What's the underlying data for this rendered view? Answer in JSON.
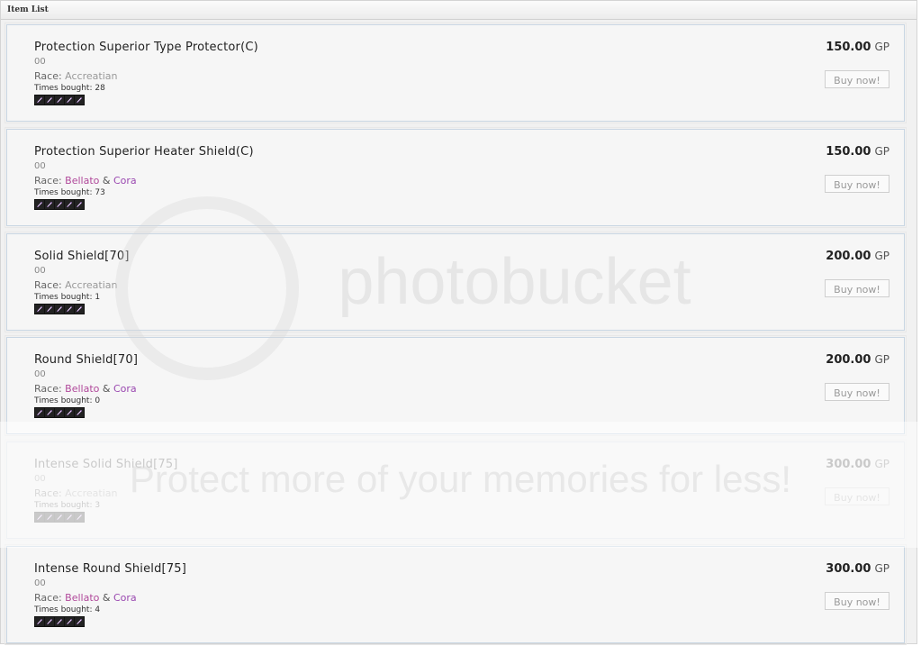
{
  "panel": {
    "title": "Item List"
  },
  "items": [
    {
      "name": "Protection Superior Type Protector(C)",
      "code": "00",
      "race_label": "Race:",
      "race1": "Accreatian",
      "race2": "",
      "amp": "",
      "bought_label": "Times bought:",
      "bought": "28",
      "price": "150.00",
      "unit": "GP",
      "buy": "Buy now!"
    },
    {
      "name": "Protection Superior Heater Shield(C)",
      "code": "00",
      "race_label": "Race:",
      "race1": "Bellato",
      "race2": "Cora",
      "amp": "&",
      "bought_label": "Times bought:",
      "bought": "73",
      "price": "150.00",
      "unit": "GP",
      "buy": "Buy now!"
    },
    {
      "name": "Solid Shield[70]",
      "code": "00",
      "race_label": "Race:",
      "race1": "Accreatian",
      "race2": "",
      "amp": "",
      "bought_label": "Times bought:",
      "bought": "1",
      "price": "200.00",
      "unit": "GP",
      "buy": "Buy now!"
    },
    {
      "name": "Round Shield[70]",
      "code": "00",
      "race_label": "Race:",
      "race1": "Bellato",
      "race2": "Cora",
      "amp": "&",
      "bought_label": "Times bought:",
      "bought": "0",
      "price": "200.00",
      "unit": "GP",
      "buy": "Buy now!"
    },
    {
      "name": "Intense Solid Shield[75]",
      "code": "00",
      "race_label": "Race:",
      "race1": "Accreatian",
      "race2": "",
      "amp": "",
      "bought_label": "Times bought:",
      "bought": "3",
      "price": "300.00",
      "unit": "GP",
      "buy": "Buy now!"
    },
    {
      "name": "Intense Round Shield[75]",
      "code": "00",
      "race_label": "Race:",
      "race1": "Bellato",
      "race2": "Cora",
      "amp": "&",
      "bought_label": "Times bought:",
      "bought": "4",
      "price": "300.00",
      "unit": "GP",
      "buy": "Buy now!"
    }
  ],
  "watermark": {
    "brand": "photobucket",
    "slogan": "Protect more of your memories for less!"
  },
  "colors": {
    "race_bellato": "#b0489a",
    "race_cora": "#9a48b0",
    "card_border": "#c9d6e3"
  },
  "icons": {
    "rating": "purple-feather-icon"
  }
}
